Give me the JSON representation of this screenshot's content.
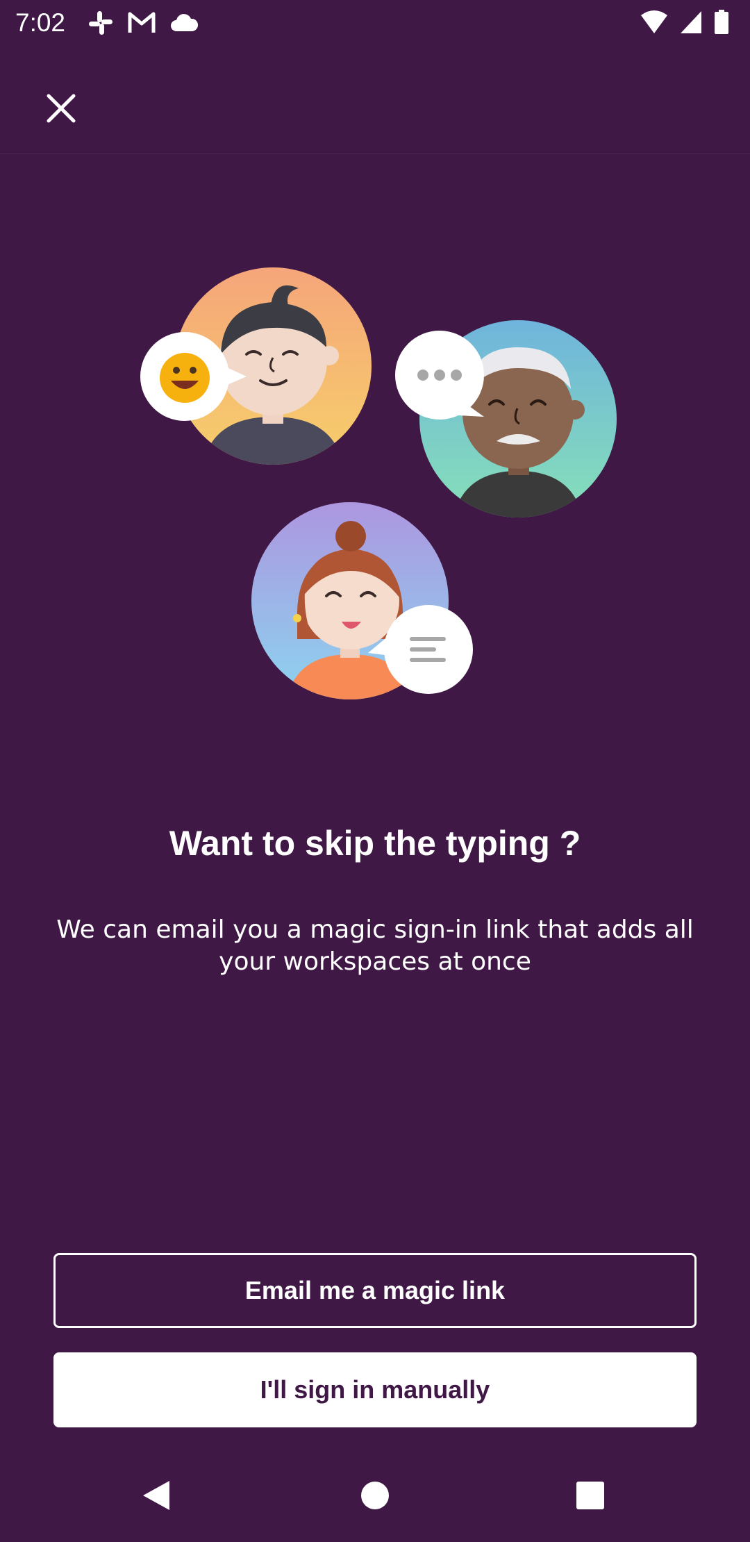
{
  "status_bar": {
    "time": "7:02",
    "left_icons": [
      "slack-icon",
      "gmail-icon",
      "cloud-icon"
    ],
    "right_icons": [
      "wifi-icon",
      "signal-icon",
      "battery-icon"
    ]
  },
  "app_bar": {
    "close_icon": "close-icon"
  },
  "content": {
    "headline": "Want to skip the typing ?",
    "subtitle": "We can email you a magic sign-in link that adds all your workspaces at once"
  },
  "buttons": {
    "magic_link_label": "Email me a magic link",
    "manual_label": "I'll sign in manually"
  },
  "nav_bar": {
    "icons": [
      "back-icon",
      "home-icon",
      "recents-icon"
    ]
  },
  "colors": {
    "background": "#3f1845",
    "button_text": "#3f1845",
    "white": "#ffffff"
  }
}
